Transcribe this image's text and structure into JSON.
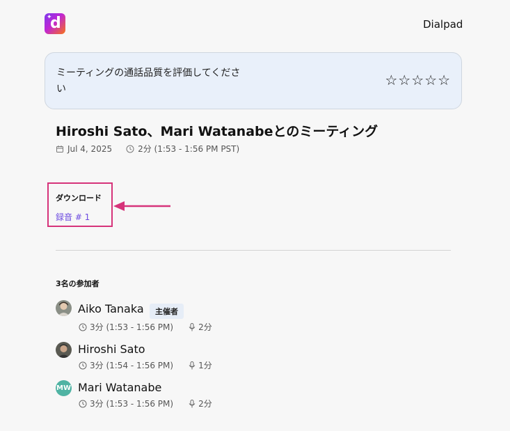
{
  "header": {
    "brand": "Dialpad",
    "logo_letter": "d"
  },
  "rating": {
    "prompt": "ミーティングの通話品質を評価してください",
    "stars": [
      "☆",
      "☆",
      "☆",
      "☆",
      "☆"
    ]
  },
  "meeting": {
    "title": "Hiroshi Sato、Mari Watanabeとのミーティング",
    "date": "Jul 4, 2025",
    "duration": "2分 (1:53 - 1:56 PM PST)"
  },
  "downloads": {
    "label": "ダウンロード",
    "link": "録音 # 1"
  },
  "participants": {
    "title": "3名の参加者",
    "host_badge": "主催者",
    "items": [
      {
        "name": "Aiko Tanaka",
        "time": "3分 (1:53 - 1:56 PM)",
        "talk": "2分"
      },
      {
        "name": "Hiroshi Sato",
        "time": "3分 (1:54 - 1:56 PM)",
        "talk": "1分"
      },
      {
        "name": "Mari Watanabe",
        "time": "3分 (1:53 - 1:56 PM)",
        "talk": "2分",
        "initials": "MW"
      }
    ]
  },
  "colors": {
    "highlight": "#d6337a",
    "link": "#6d4be0",
    "rating_bg": "#e9f0fa"
  }
}
